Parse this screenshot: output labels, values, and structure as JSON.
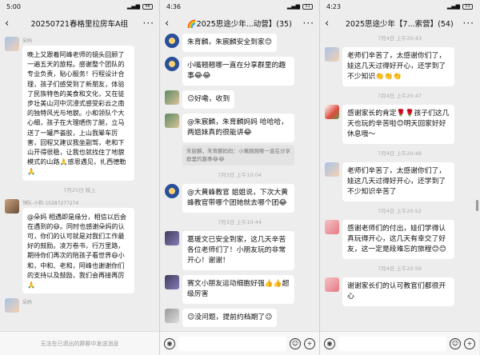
{
  "phone1": {
    "status": {
      "time": "5:00",
      "battery": "48"
    },
    "title": "20250721春格里拉房车A组",
    "messages": [
      {
        "sender": "朵妈",
        "text": "晚上又跟着阿峰老师的镜头回顾了一遍五天的旅程。感谢整个团队的专业负责，贴心服务！行程设计合理，孩子们感受到了新朋友，体验了民族特色的美食和文化，又在徒步壮美山河中沉浸式感受彩云之南的独特风光与地貌。小和领队个大心细，孩子在大理晒伤了腿，立马送了一罐芦荟胶，上山我晕车厉害，回程又建议我坐副驾，老和下山开得很稳，让我也就找住了地貌模式的山路🙏感恩遇见，扎西德勒🙏"
      },
      {
        "sender": "领队-小和-15287277274",
        "text": "@朵妈 相遇即是缘分，相信以后会在遇到的😄。同时也感谢朵妈的认可，你们的认可就是对我们工作最好的鼓励。凌万卷书，行万里路，期待你们再次的陪孩子看世界😄小和，中和、老和，阿峰也谢谢你们的支持以及鼓励，我们会再接再厉🙏"
      },
      {
        "sender": "朵妈",
        "text": ""
      }
    ],
    "times": [
      "7月25日 晚上"
    ],
    "bottom_notice": "无法在已退出的群聊中发送消息"
  },
  "phone2": {
    "status": {
      "time": "4:36",
      "battery": "51"
    },
    "title": "🌈2025思途少年...动营】(35)",
    "messages": [
      {
        "text": "朱育麟，朱宸麟安全到家😊"
      },
      {
        "text": "小嘴翘翘哪一直在分享群里的趣事😂😂"
      },
      {
        "text": "😉好嘞，收到"
      },
      {
        "text": "@朱宸麟，朱育麟妈妈 哈哈哈，两姐妹真的很能讲😂",
        "quote": "朱宸麟，朱育麟妈妈：小嘴翘翘哪一直在分享群里的趣事😂😂"
      },
      {
        "text": "@大黄蜂教官 姐姐说，下次大黄蜂教官带哪个团她就去哪个团😂"
      },
      {
        "text": "葛瑗文已安全到家，这几天辛苦各位老师们了！小朋友玩的非常开心！谢谢！"
      },
      {
        "text": "赛文小朋友运动细胞好强👍👍超级厉害"
      },
      {
        "text": "😉没问题，提前约档期了😉"
      }
    ],
    "times": [
      "7月3日",
      "7月3日 上午10:04",
      "7月3日 上午10:44"
    ]
  },
  "phone3": {
    "status": {
      "time": "4:23",
      "battery": "53"
    },
    "title": "2025思途少年【7...索营】(54)",
    "messages": [
      {
        "text": "老师们辛苦了，太感谢你们了，娃这几天过得好开心，还学到了不少知识👏👏👏"
      },
      {
        "text": "感谢家长的肯定🌹🌹孩子们这几天也玩的辛苦啦😊明天回家好好休息哦～"
      },
      {
        "text": "老师们辛苦了，太感谢你们了，娃这几天过得好开心，还学到了不少知识辛苦了"
      },
      {
        "text": "感谢老师们的付出，娃们学得认真玩得开心，这几天有幸交了好友，这一定是段难忘的旅程😊😊"
      },
      {
        "text": "谢谢家长们的认可教官们都很开心"
      }
    ],
    "times": [
      "7月4日 上午20:43",
      "7月4日 上午20:47",
      "7月4日 上午20:48",
      "7月4日 上午20:52",
      "7月4日 上午20:59"
    ]
  }
}
